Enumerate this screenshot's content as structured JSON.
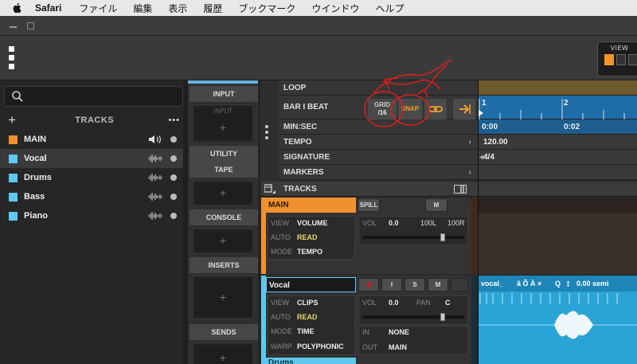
{
  "menubar": {
    "app": "Safari",
    "items": [
      "ファイル",
      "編集",
      "表示",
      "履歴",
      "ブックマーク",
      "ウインドウ",
      "ヘルプ"
    ]
  },
  "view": {
    "label": "VIEW"
  },
  "browser": {
    "search_placeholder": "",
    "header": "TRACKS",
    "tracks": [
      {
        "name": "MAIN",
        "color": "#f0902f"
      },
      {
        "name": "Vocal",
        "color": "#5fc8f0"
      },
      {
        "name": "Drums",
        "color": "#5fc8f0"
      },
      {
        "name": "Bass",
        "color": "#5fc8f0"
      },
      {
        "name": "Piano",
        "color": "#5fc8f0"
      }
    ]
  },
  "inspector": {
    "input_header": "INPUT",
    "input_slot_label": "INPUT",
    "utility_header": "UTILITY",
    "tape_header": "TAPE",
    "console_header": "CONSOLE",
    "inserts_header": "INSERTS",
    "sends_header": "SENDS",
    "plus": "+"
  },
  "global": {
    "loop": "LOOP",
    "bar_beat": "BAR I BEAT",
    "grid_label": "GRID",
    "grid_value": "/16",
    "snap_label": "SNAP",
    "min_sec": "MIN:SEC",
    "tempo": "TEMPO",
    "signature": "SIGNATURE",
    "markers": "MARKERS",
    "tracks": "TRACKS"
  },
  "timeline": {
    "bar1": "1",
    "bar2": "2",
    "time1": "0:00",
    "time2": "0:02",
    "tempo": "120.00",
    "signature": "4/4"
  },
  "main_track": {
    "name": "MAIN",
    "spill": "SPILL",
    "m": "M",
    "view_k": "VIEW",
    "view_v": "VOLUME",
    "auto_k": "AUTO",
    "auto_v": "READ",
    "mode_k": "MODE",
    "mode_v": "TEMPO",
    "vol_k": "VOL",
    "vol_v": "0.0",
    "left": "100L",
    "right": "100R",
    "volume_level": 0.8
  },
  "vocal_track": {
    "name": "Vocal",
    "i": "I",
    "s": "S",
    "m": "M",
    "view_k": "VIEW",
    "view_v": "CLIPS",
    "auto_k": "AUTO",
    "auto_v": "READ",
    "mode_k": "MODE",
    "mode_v": "TIME",
    "warp_k": "WARP",
    "warp_v": "POLYPHONIC",
    "vol_k": "VOL",
    "vol_v": "0.0",
    "pan_k": "PAN",
    "pan_v": "C",
    "in_k": "IN",
    "in_v": "NONE",
    "out_k": "OUT",
    "out_v": "MAIN",
    "volume_level": 0.8,
    "clip_name": "vocal_",
    "clip_flags": "ã Õ Ä ×",
    "clip_q": "Q",
    "clip_hash": "‡",
    "clip_semi": "0.00 semi"
  },
  "drums_track": {
    "name": "Drums"
  }
}
